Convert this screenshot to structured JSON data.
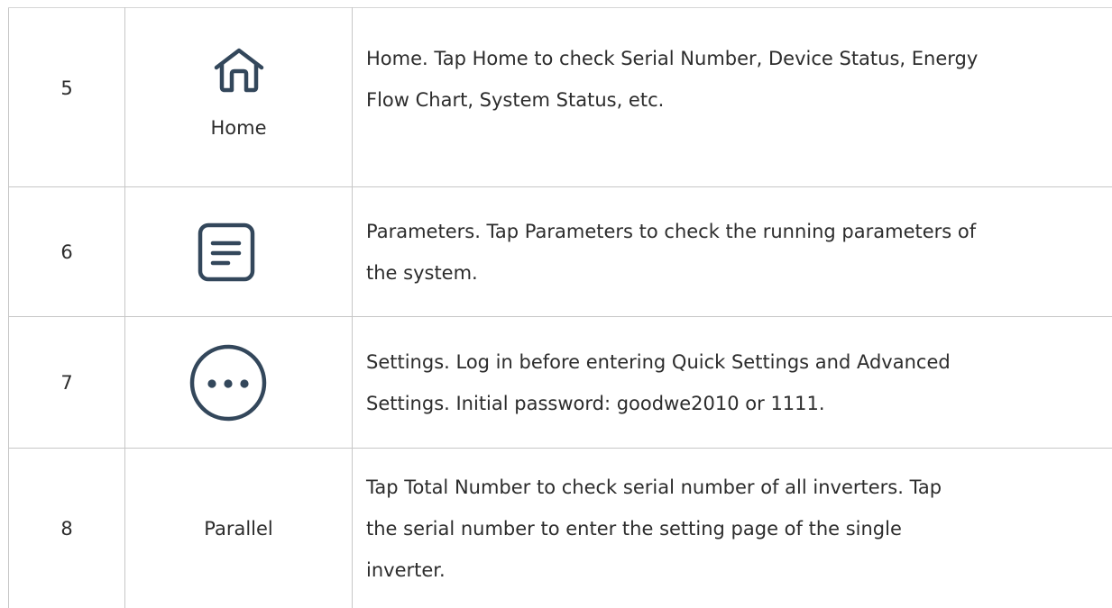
{
  "rows": [
    {
      "number": "5",
      "icon": "home-icon",
      "icon_label": "Home",
      "description_lines": [
        "Home. Tap Home to check Serial Number, Device Status, Energy",
        "Flow Chart, System Status, etc."
      ]
    },
    {
      "number": "6",
      "icon": "document-icon",
      "icon_label": "",
      "description_lines": [
        "Parameters. Tap Parameters to check the running parameters of",
        "the system."
      ]
    },
    {
      "number": "7",
      "icon": "more-dots-icon",
      "icon_label": "",
      "description_lines": [
        "Settings. Log in before entering Quick Settings and Advanced",
        "Settings. Initial password: goodwe2010 or 1111."
      ]
    },
    {
      "number": "8",
      "icon": "",
      "icon_label": "Parallel",
      "description_lines": [
        "Tap Total Number to check serial number of all inverters. Tap",
        "the serial number to enter the setting page of the single",
        "inverter."
      ]
    }
  ],
  "colors": {
    "text": "#2c2c2c",
    "border": "#c7c7c7",
    "icon_stroke": "#33475b"
  }
}
